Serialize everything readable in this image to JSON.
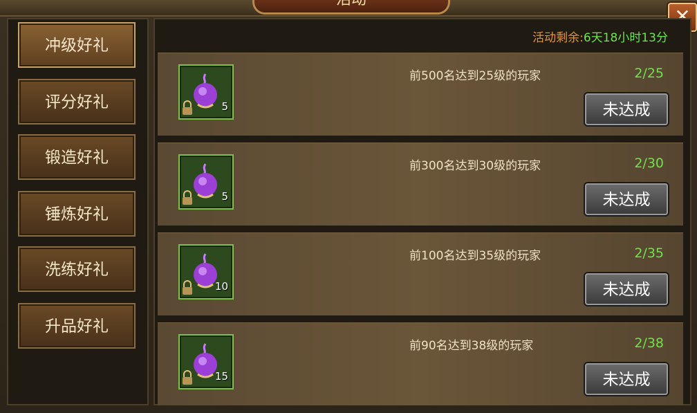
{
  "window": {
    "title": "活动"
  },
  "sidebar": {
    "items": [
      {
        "label": "冲级好礼",
        "active": true
      },
      {
        "label": "评分好礼",
        "active": false
      },
      {
        "label": "锻造好礼",
        "active": false
      },
      {
        "label": "锤炼好礼",
        "active": false
      },
      {
        "label": "洗练好礼",
        "active": false
      },
      {
        "label": "升品好礼",
        "active": false
      }
    ]
  },
  "main": {
    "remaining_label": "活动剩余:",
    "remaining_value": "6天18小时13分",
    "rewards": [
      {
        "task": "前500名达到25级的玩家",
        "progress": "2/25",
        "count": "5",
        "status": "未达成",
        "icon": "purple-gem-icon"
      },
      {
        "task": "前300名达到30级的玩家",
        "progress": "2/30",
        "count": "5",
        "status": "未达成",
        "icon": "purple-gem-icon"
      },
      {
        "task": "前100名达到35级的玩家",
        "progress": "2/35",
        "count": "10",
        "status": "未达成",
        "icon": "purple-gem-icon"
      },
      {
        "task": "前90名达到38级的玩家",
        "progress": "2/38",
        "count": "15",
        "status": "未达成",
        "icon": "purple-gem-icon"
      }
    ]
  },
  "colors": {
    "accent_green": "#6ee34a",
    "accent_orange": "#e2943a",
    "gem_purple": "#9b3fd6"
  }
}
